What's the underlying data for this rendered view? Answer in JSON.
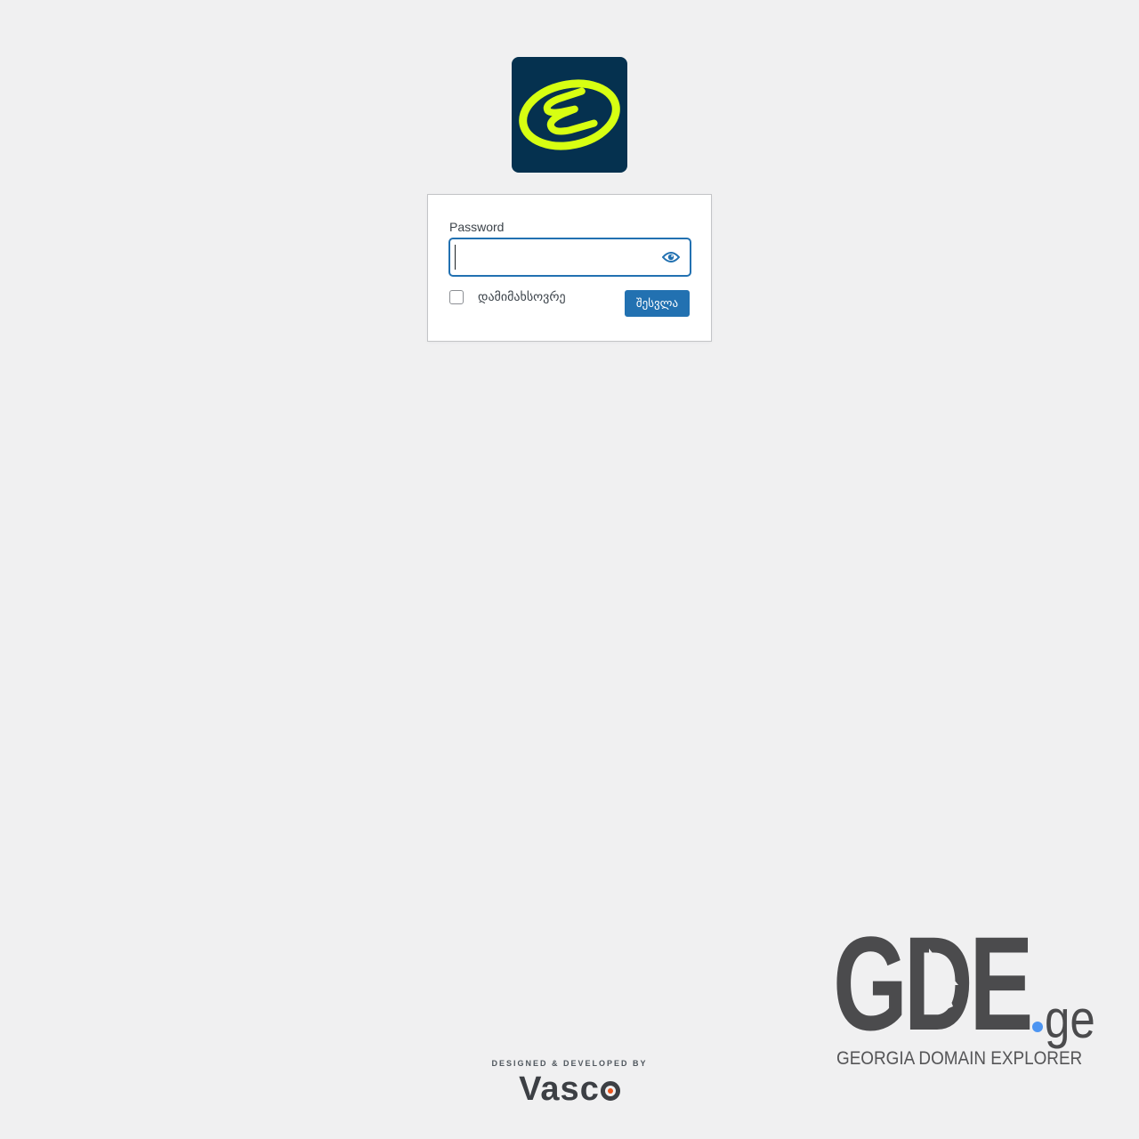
{
  "login": {
    "password_label": "Password",
    "password_value": "",
    "remember_label": "დამიმახსოვრე",
    "remember_checked": false,
    "submit_label": "შესვლა"
  },
  "icons": {
    "site_logo": "site-logo-emblem",
    "show_password": "eye-icon"
  },
  "footer": {
    "credit_text": "DESIGNED & DEVELOPED BY",
    "credit_brand": "Vasc"
  },
  "brand": {
    "name": "GDE",
    "tld": "ge",
    "tagline": "GEORGIA DOMAIN EXPLORER"
  },
  "colors": {
    "background": "#f0f0f1",
    "accent": "#2271b1",
    "logo_bg": "#05314f",
    "logo_mark": "#d7ff12",
    "brand_dot": "#4d95f2",
    "vasco_dot": "#e8541e"
  }
}
